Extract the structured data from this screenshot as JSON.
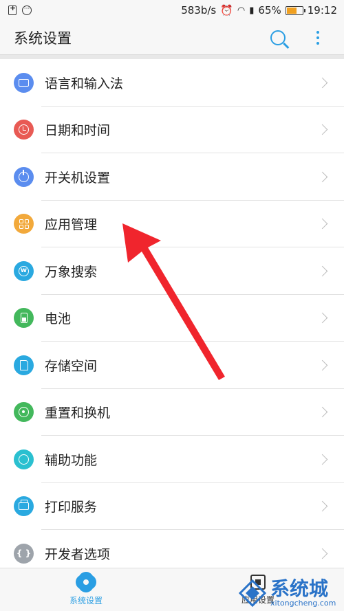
{
  "status_bar": {
    "speed": "583b/s",
    "battery_percent": "65%",
    "battery_level": 0.65,
    "time": "19:12"
  },
  "header": {
    "title": "系统设置",
    "search_icon": "search-icon",
    "more_icon": "more-vertical-icon"
  },
  "settings": {
    "items": [
      {
        "label": "语言和输入法",
        "icon": "keyboard-icon",
        "color": "#5b8def"
      },
      {
        "label": "日期和时间",
        "icon": "clock-icon",
        "color": "#e85a54"
      },
      {
        "label": "开关机设置",
        "icon": "power-icon",
        "color": "#5b8def"
      },
      {
        "label": "应用管理",
        "icon": "apps-grid-icon",
        "color": "#f2a93b"
      },
      {
        "label": "万象搜索",
        "icon": "search-w-icon",
        "color": "#2aa9e0"
      },
      {
        "label": "电池",
        "icon": "battery-icon",
        "color": "#43b85c"
      },
      {
        "label": "存储空间",
        "icon": "storage-icon",
        "color": "#2aa9e0"
      },
      {
        "label": "重置和换机",
        "icon": "reset-icon",
        "color": "#43b85c"
      },
      {
        "label": "辅助功能",
        "icon": "accessibility-icon",
        "color": "#2ac0d0"
      },
      {
        "label": "打印服务",
        "icon": "printer-icon",
        "color": "#2aa9e0"
      },
      {
        "label": "开发者选项",
        "icon": "developer-icon",
        "color": "#9ea4ab"
      }
    ]
  },
  "bottom_nav": {
    "tabs": [
      {
        "label": "系统设置",
        "active": true
      },
      {
        "label": "应用设置",
        "active": false
      }
    ]
  },
  "watermark": {
    "brand": "系统城",
    "domain": "xitongcheng.com"
  },
  "colors": {
    "accent": "#2a9ee3",
    "annotation_arrow": "#f0252d"
  }
}
